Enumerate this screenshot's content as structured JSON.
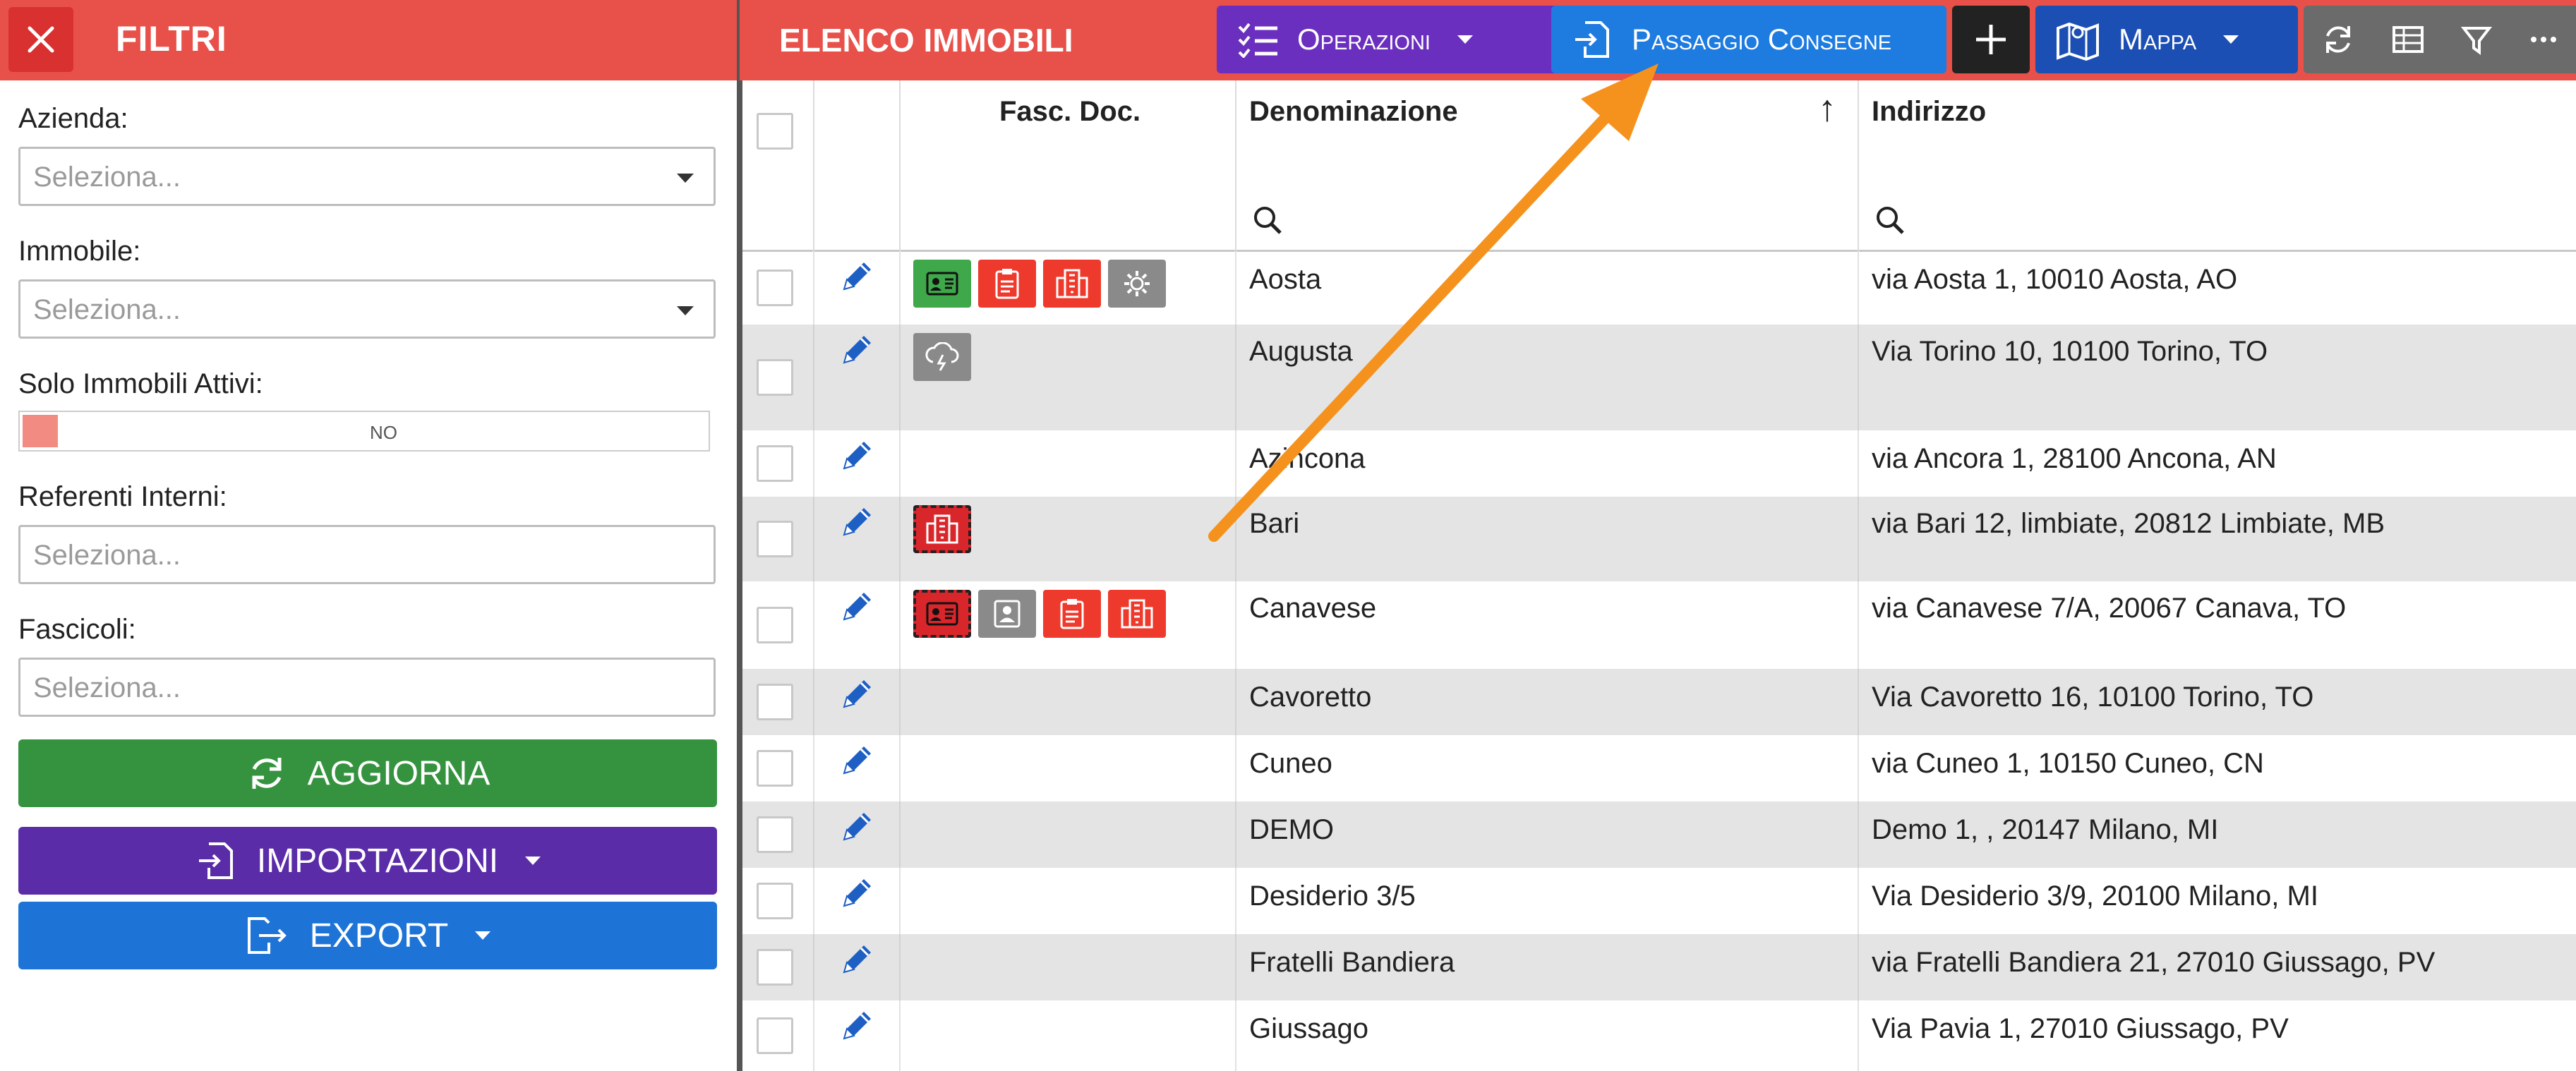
{
  "filters": {
    "title": "FILTRI",
    "close_icon": "close-icon",
    "azienda_label": "Azienda:",
    "azienda_placeholder": "Seleziona...",
    "immobile_label": "Immobile:",
    "immobile_placeholder": "Seleziona...",
    "solo_attivi_label": "Solo Immobili Attivi:",
    "solo_attivi_value": "NO",
    "referenti_label": "Referenti Interni:",
    "referenti_placeholder": "Seleziona...",
    "fascicoli_label": "Fascicoli:",
    "fascicoli_placeholder": "Seleziona...",
    "aggiorna_label": "AGGIORNA",
    "importazioni_label": "IMPORTAZIONI",
    "export_label": "EXPORT"
  },
  "toolbar": {
    "title": "ELENCO IMMOBILI",
    "operazioni_label": "Operazioni",
    "passaggio_label": "Passaggio Consegne",
    "mappa_label": "Mappa"
  },
  "colors": {
    "header_red": "#e8504a",
    "operazioni_purple": "#6a2fbf",
    "passaggio_blue": "#1e7be0",
    "mappa_blue": "#1c4fb4",
    "aggiorna_green": "#35933f",
    "importazioni_purple": "#5a2ca8",
    "export_blue": "#1e74d6",
    "arrow_orange": "#f5921e"
  },
  "table": {
    "headers": {
      "fasc_doc": "Fasc. Doc.",
      "denominazione": "Denominazione",
      "indirizzo": "Indirizzo"
    },
    "sort_indicator": "↑",
    "rows": [
      {
        "denominazione": "Aosta",
        "indirizzo": "via Aosta 1, 10010 Aosta, AO",
        "docs": [
          "id-card-icon",
          "clipboard-icon",
          "building-icon",
          "gear-icon"
        ]
      },
      {
        "denominazione": "Augusta",
        "indirizzo": "Via Torino 10, 10100 Torino, TO",
        "docs": [
          "cloud-lightning-icon"
        ]
      },
      {
        "denominazione": "Azincona",
        "indirizzo": "via Ancora 1, 28100 Ancona, AN",
        "docs": []
      },
      {
        "denominazione": "Bari",
        "indirizzo": "via Bari 12, limbiate, 20812 Limbiate, MB",
        "docs": [
          "building-icon"
        ]
      },
      {
        "denominazione": "Canavese",
        "indirizzo": "via Canavese 7/A, 20067 Canava, TO",
        "docs": [
          "id-card-icon",
          "person-icon",
          "clipboard-icon",
          "building-icon"
        ]
      },
      {
        "denominazione": "Cavoretto",
        "indirizzo": "Via Cavoretto 16, 10100 Torino, TO",
        "docs": []
      },
      {
        "denominazione": "Cuneo",
        "indirizzo": "via Cuneo 1, 10150 Cuneo, CN",
        "docs": []
      },
      {
        "denominazione": "DEMO",
        "indirizzo": "Demo 1, , 20147 Milano, MI",
        "docs": []
      },
      {
        "denominazione": "Desiderio 3/5",
        "indirizzo": "Via Desiderio 3/9, 20100 Milano, MI",
        "docs": []
      },
      {
        "denominazione": "Fratelli Bandiera",
        "indirizzo": "via Fratelli Bandiera 21, 27010 Giussago, PV",
        "docs": []
      },
      {
        "denominazione": "Giussago",
        "indirizzo": "Via Pavia 1, 27010 Giussago, PV",
        "docs": []
      }
    ]
  }
}
